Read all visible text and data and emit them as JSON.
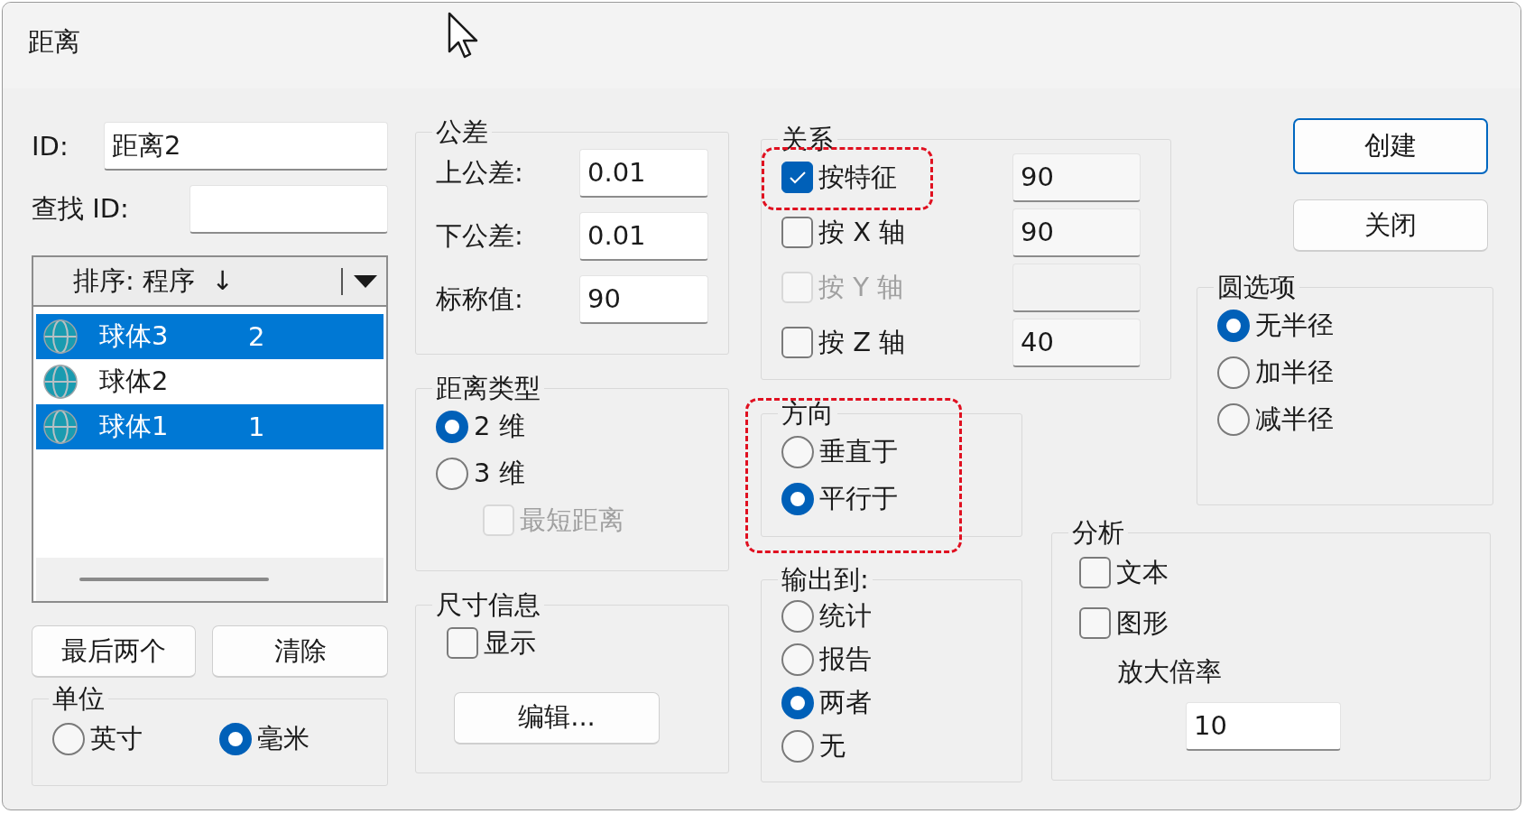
{
  "window": {
    "title": "距离"
  },
  "id_field": {
    "label": "ID:",
    "value": "距离2"
  },
  "find_id": {
    "label": "查找 ID:"
  },
  "sort": {
    "label": "排序:",
    "value": "程序",
    "arrow": "↓"
  },
  "list": [
    {
      "name": "球体3",
      "number": "2",
      "selected": true
    },
    {
      "name": "球体2",
      "selected": false
    },
    {
      "name": "球体1",
      "number": "1",
      "selected": true
    }
  ],
  "list_buttons": [
    "最后两个",
    "清除"
  ],
  "units": {
    "title": "单位",
    "options": [
      {
        "label": "英寸",
        "selected": false
      },
      {
        "label": "毫米",
        "selected": true
      }
    ]
  },
  "tolerance": {
    "title": "公差",
    "fields": [
      {
        "label": "上公差:",
        "value": "0.01"
      },
      {
        "label": "下公差:",
        "value": "0.01"
      },
      {
        "label": "标称值:",
        "value": "90"
      }
    ]
  },
  "distance_type": {
    "title": "距离类型",
    "options": [
      {
        "label": "2 维",
        "selected": true
      },
      {
        "label": "3 维",
        "selected": false
      }
    ],
    "shortest": {
      "label": "最短距离",
      "checked": false,
      "disabled": true
    }
  },
  "dimension_info": {
    "title": "尺寸信息",
    "show": {
      "label": "显示",
      "checked": false
    },
    "button": "编辑..."
  },
  "relation": {
    "title": "关系",
    "items": [
      {
        "label": "按特征",
        "checked": true,
        "disabled": false,
        "value": "90",
        "highlighted": true
      },
      {
        "label": "按 X 轴",
        "checked": false,
        "disabled": false,
        "value": "90",
        "highlighted": false
      },
      {
        "label": "按 Y 轴",
        "checked": false,
        "disabled": true,
        "highlighted": false
      },
      {
        "label": "按 Z 轴",
        "checked": false,
        "disabled": false,
        "value": "40",
        "highlighted": false
      }
    ]
  },
  "direction": {
    "title": "方向",
    "highlighted": true,
    "options": [
      {
        "label": "垂直于",
        "selected": false
      },
      {
        "label": "平行于",
        "selected": true
      }
    ]
  },
  "output": {
    "title": "输出到:",
    "options": [
      {
        "label": "统计",
        "selected": false
      },
      {
        "label": "报告",
        "selected": false
      },
      {
        "label": "两者",
        "selected": true
      },
      {
        "label": "无",
        "selected": false
      }
    ]
  },
  "actions": [
    {
      "label": "创建",
      "default": true
    },
    {
      "label": "关闭",
      "default": false
    }
  ],
  "circle_options": {
    "title": "圆选项",
    "options": [
      {
        "label": "无半径",
        "selected": true
      },
      {
        "label": "加半径",
        "selected": false
      },
      {
        "label": "减半径",
        "selected": false
      }
    ]
  },
  "analysis": {
    "title": "分析",
    "options": [
      {
        "label": "文本",
        "checked": false
      },
      {
        "label": "图形",
        "checked": false
      }
    ],
    "magnification": {
      "label": "放大倍率",
      "value": "10"
    }
  }
}
